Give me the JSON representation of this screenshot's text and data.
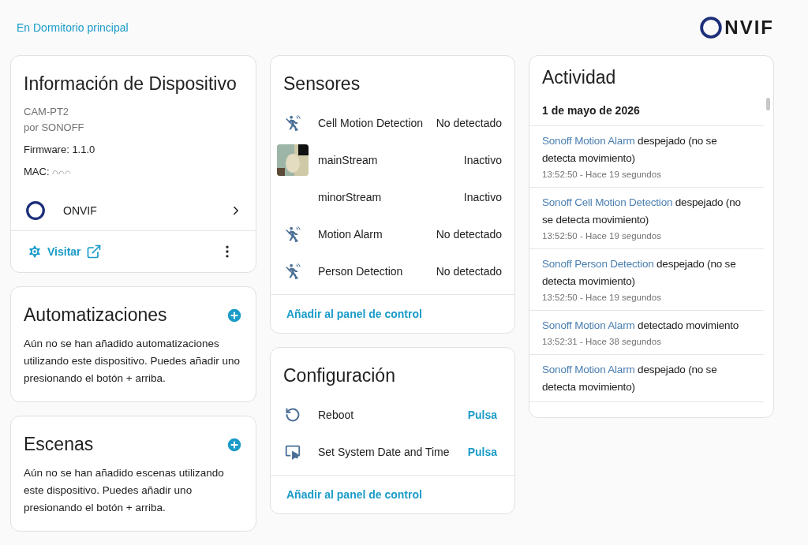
{
  "breadcrumb": "En Dormitorio principal",
  "logo": {
    "text": "NVIF"
  },
  "device_info": {
    "title": "Información de Dispositivo",
    "model": "CAM-PT2",
    "manufacturer": "por SONOFF",
    "firmware": "Firmware: 1.1.0",
    "mac_label": "MAC:",
    "integration": "ONVIF",
    "visit": "Visitar"
  },
  "automations": {
    "title": "Automatizaciones",
    "text": "Aún no se han añadido automatizaciones utilizando este dispositivo. Puedes añadir uno presionando el botón + arriba."
  },
  "scenes": {
    "title": "Escenas",
    "text": "Aún no se han añadido escenas utilizando este dispositivo. Puedes añadir uno presionando el botón + arriba."
  },
  "sensors": {
    "title": "Sensores",
    "items": [
      {
        "kind": "motion",
        "name": "Cell Motion Detection",
        "state": "No detectado"
      },
      {
        "kind": "camera",
        "name": "mainStream",
        "state": "Inactivo"
      },
      {
        "kind": "blank",
        "name": "minorStream",
        "state": "Inactivo"
      },
      {
        "kind": "motion",
        "name": "Motion Alarm",
        "state": "No detectado"
      },
      {
        "kind": "motion",
        "name": "Person Detection",
        "state": "No detectado"
      }
    ],
    "add": "Añadir al panel de control"
  },
  "configuration": {
    "title": "Configuración",
    "items": [
      {
        "kind": "restart",
        "name": "Reboot",
        "action": "Pulsa"
      },
      {
        "kind": "screen",
        "name": "Set System Date and Time",
        "action": "Pulsa"
      }
    ],
    "add": "Añadir al panel de control"
  },
  "activity": {
    "title": "Actividad",
    "date": "1 de mayo de 2026",
    "entries": [
      {
        "entity": "Sonoff Motion Alarm",
        "message": "despejado (no se detecta movimiento)",
        "time": "13:52:50 - Hace 19 segundos"
      },
      {
        "entity": "Sonoff Cell Motion Detection",
        "message": "despejado (no se detecta movimiento)",
        "time": "13:52:50 - Hace 19 segundos"
      },
      {
        "entity": "Sonoff Person Detection",
        "message": "despejado (no se detecta movimiento)",
        "time": "13:52:50 - Hace 19 segundos"
      },
      {
        "entity": "Sonoff Motion Alarm",
        "message": "detectado movimiento",
        "time": "13:52:31 - Hace 38 segundos"
      },
      {
        "entity": "Sonoff Motion Alarm",
        "message": "despejado (no se detecta movimiento)"
      }
    ]
  }
}
